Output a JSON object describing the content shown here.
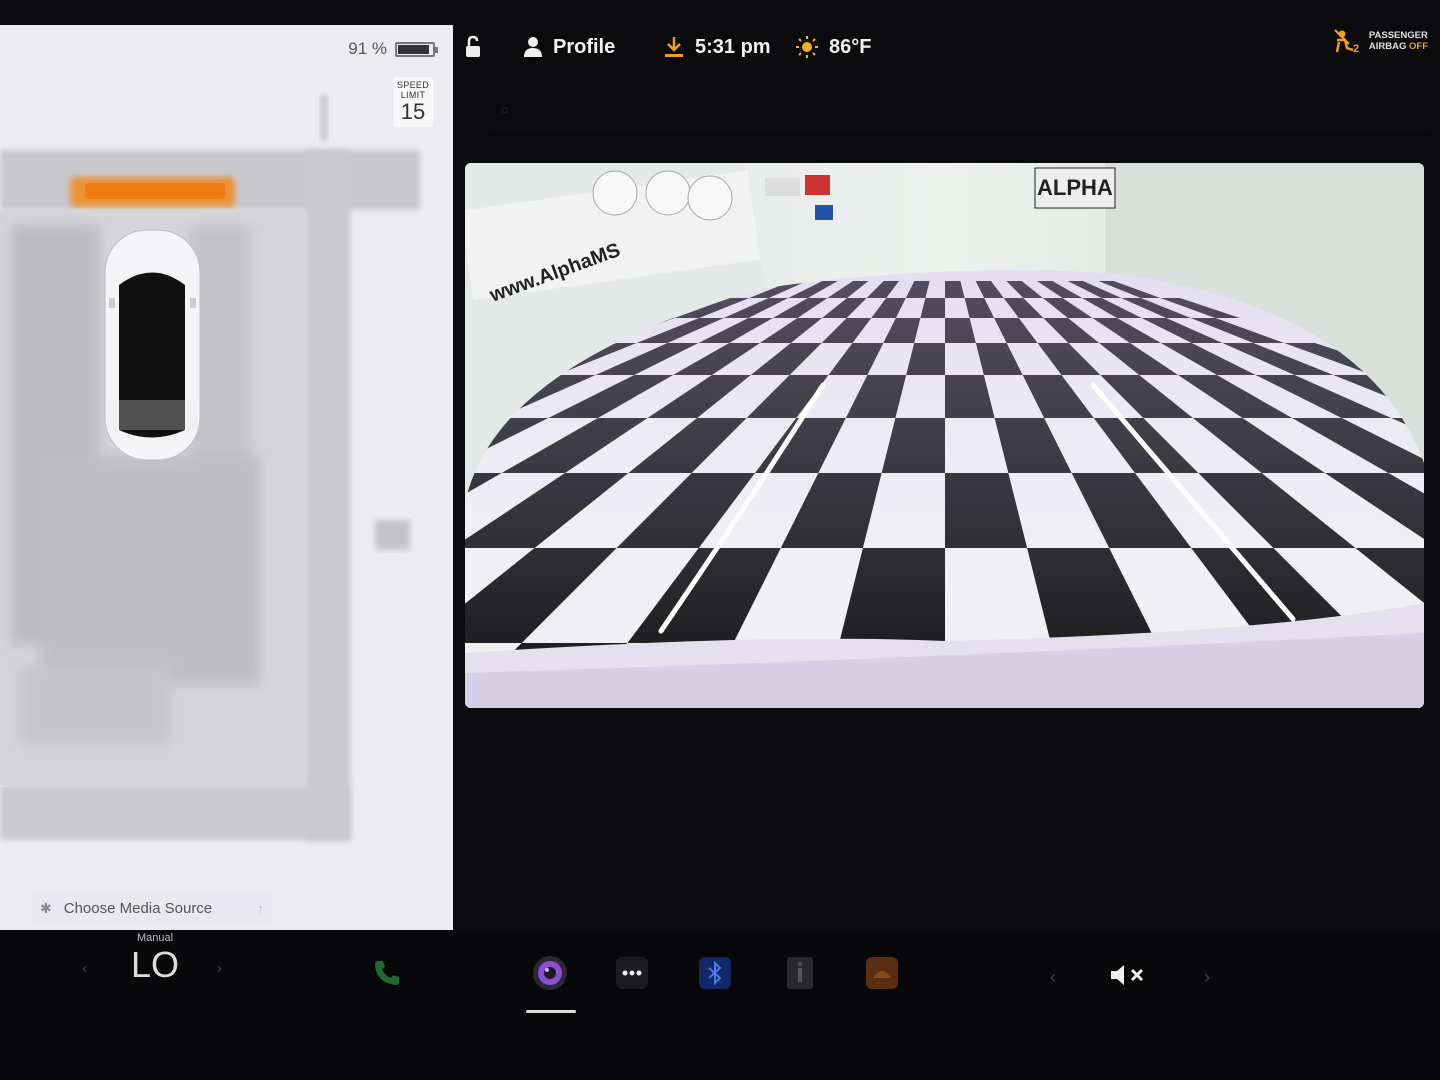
{
  "battery": {
    "percent_label": "91 %",
    "level": 0.91
  },
  "speed_limit": {
    "label": "SPEED LIMIT",
    "value": "15"
  },
  "media": {
    "label": "Choose Media Source"
  },
  "status": {
    "profile_label": "Profile",
    "time": "5:31 pm",
    "temperature": "86°F",
    "airbag_line1": "PASSENGER",
    "airbag_line2": "AIRBAG",
    "airbag_state": "OFF"
  },
  "climate": {
    "mode": "Manual",
    "temp": "LO"
  },
  "colors": {
    "accent_orange": "#f0a020",
    "camera_purple": "#8a4fd8",
    "bluetooth_blue": "#2e5bd6"
  },
  "icons": [
    "lock-open-icon",
    "profile-icon",
    "download-icon",
    "sun-icon",
    "airbag-icon",
    "phone-icon",
    "camera-icon",
    "more-icon",
    "bluetooth-icon",
    "info-icon",
    "toybox-icon",
    "mute-icon"
  ]
}
